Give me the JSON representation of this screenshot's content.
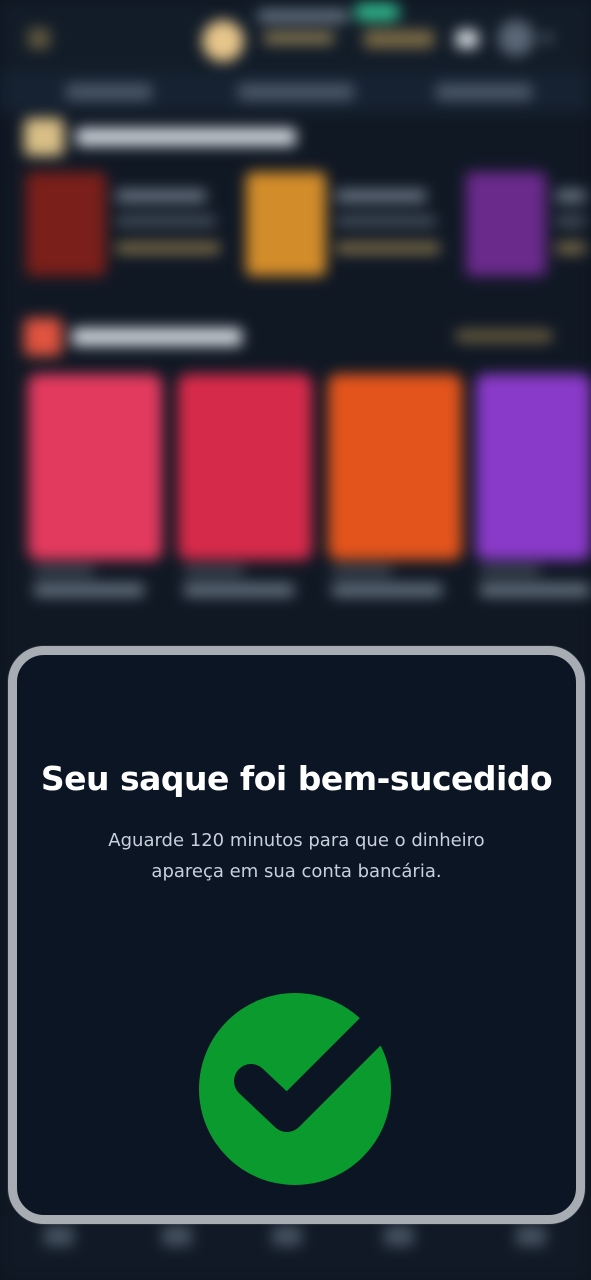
{
  "modal": {
    "title": "Seu saque foi bem-sucedido",
    "message": "Aguarde 120 minutos para que o dinheiro apareça em sua conta bancária.",
    "icon": "check-circle-icon",
    "icon_color": "#0a9a2e"
  },
  "colors": {
    "modal_background": "#0b1524",
    "modal_border": "#a7adb3",
    "text_primary": "#ffffff",
    "text_secondary": "#c8d0da"
  }
}
